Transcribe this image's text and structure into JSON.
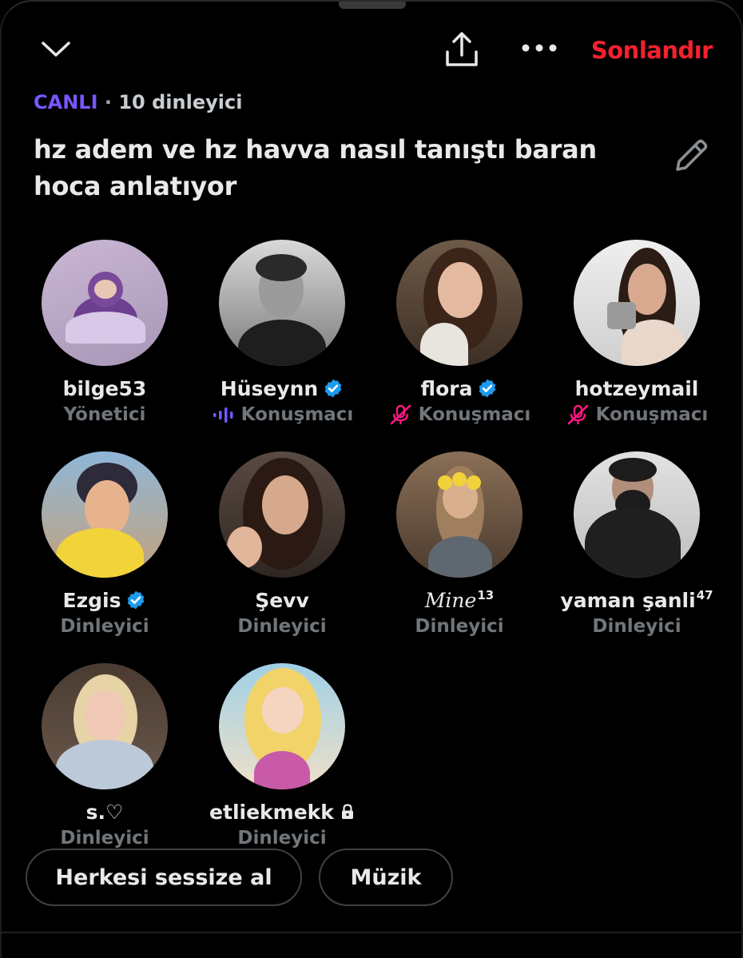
{
  "header": {
    "collapse_icon": "chevron-down-icon",
    "share_icon": "share-icon",
    "more_icon": "more-icon",
    "end_label": "Sonlandır"
  },
  "status": {
    "live_label": "CANLI",
    "separator": "·",
    "listeners_label": "10 dinleyici"
  },
  "space": {
    "title": "hz adem ve hz havva nasıl tanıştı baran hoca anlatıyor",
    "edit_icon": "pencil-icon"
  },
  "participants": [
    {
      "name": "bilge53",
      "role": "Yönetici",
      "verified": false,
      "role_icon": ""
    },
    {
      "name": "Hüseynn",
      "role": "Konuşmacı",
      "verified": true,
      "role_icon": "speaking-wave-icon"
    },
    {
      "name": "flora",
      "role": "Konuşmacı",
      "verified": true,
      "role_icon": "mic-off-icon"
    },
    {
      "name": "hotzeymail",
      "role": "Konuşmacı",
      "verified": false,
      "role_icon": "mic-off-icon"
    },
    {
      "name": "Ezgis",
      "role": "Dinleyici",
      "verified": true,
      "role_icon": ""
    },
    {
      "name": "Şevv",
      "role": "Dinleyici",
      "verified": false,
      "role_icon": ""
    },
    {
      "name": "Mine",
      "name_sup": "13",
      "role": "Dinleyici",
      "verified": false,
      "role_icon": ""
    },
    {
      "name": "yaman şanli",
      "name_sup": "47",
      "role": "Dinleyici",
      "verified": false,
      "role_icon": ""
    },
    {
      "name": "s.♡",
      "role": "Dinleyici",
      "verified": false,
      "role_icon": ""
    },
    {
      "name": "etliekmekk",
      "role": "Dinleyici",
      "verified": false,
      "locked": true,
      "role_icon": ""
    }
  ],
  "actions": {
    "mute_all_label": "Herkesi sessize al",
    "music_label": "Müzik"
  },
  "colors": {
    "live": "#7856ff",
    "end": "#f4212e",
    "muted": "#f91880",
    "verified": "#1d9bf0",
    "role_text": "#71767b"
  }
}
